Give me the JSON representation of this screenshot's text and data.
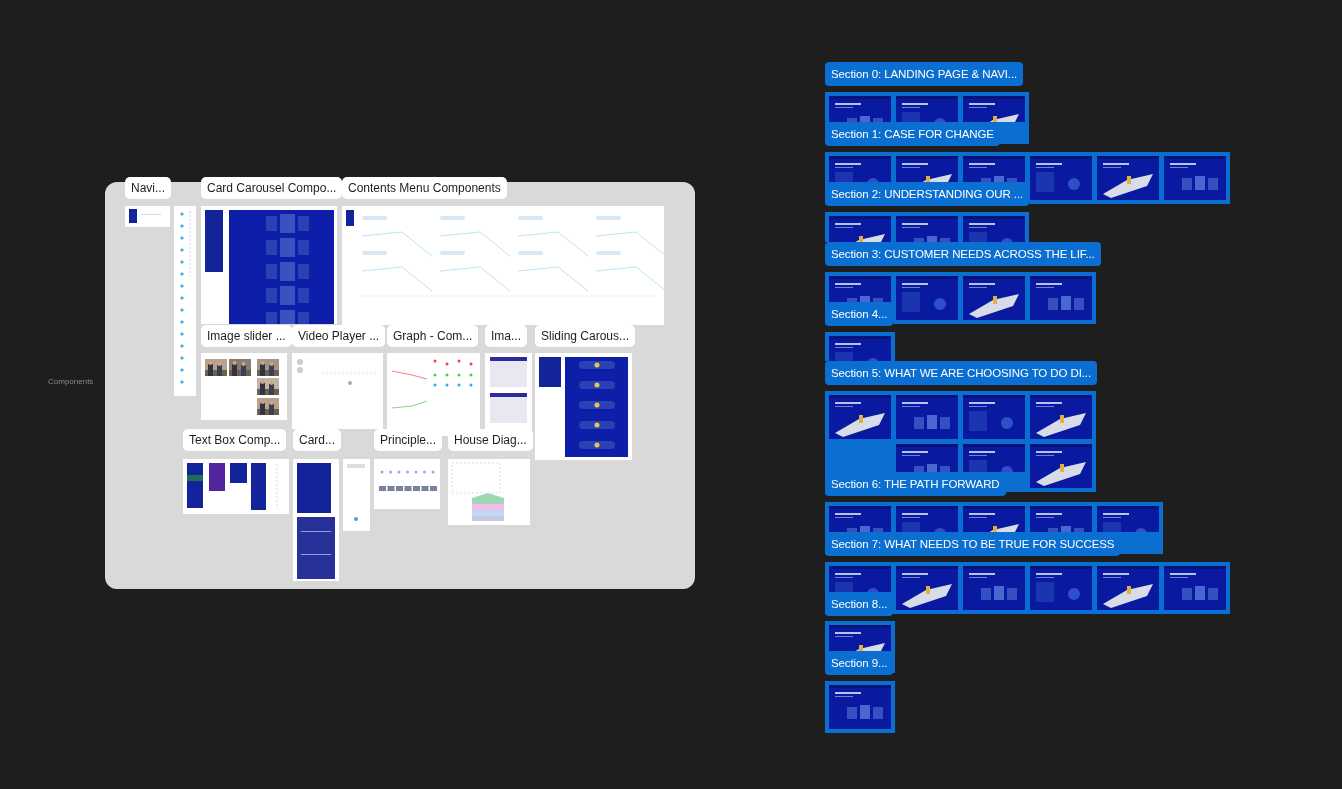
{
  "canvas_label": "Components",
  "components": {
    "frames": [
      {
        "label": "Navi..."
      },
      {
        "label": "Card Carousel Compo..."
      },
      {
        "label": "Contents Menu Components"
      },
      {
        "label": "Image slider ..."
      },
      {
        "label": "Video Player ..."
      },
      {
        "label": "Graph - Com..."
      },
      {
        "label": "Ima..."
      },
      {
        "label": "Sliding Carous..."
      },
      {
        "label": "Text Box Comp..."
      },
      {
        "label": "Card..."
      },
      {
        "label": "Principle..."
      },
      {
        "label": "House Diag..."
      }
    ]
  },
  "sections": [
    {
      "label": "Section 0: LANDING PAGE & NAVI..."
    },
    {
      "label": "Section 1: CASE FOR CHANGE",
      "slides": [
        {
          "kind": "picture"
        },
        {
          "kind": "picture"
        },
        {
          "kind": "picture"
        }
      ]
    },
    {
      "label": "Section 2: UNDERSTANDING OUR ...",
      "slides": [
        {
          "kind": "picture"
        },
        {
          "kind": "picture"
        },
        {
          "kind": "picture"
        },
        {
          "kind": "picture"
        },
        {
          "kind": "picture"
        },
        {
          "kind": "picture"
        }
      ]
    },
    {
      "label": "Section 3: CUSTOMER NEEDS ACROSS THE LIF...",
      "slides": [
        {
          "kind": "picture"
        },
        {
          "kind": "picture"
        },
        {
          "kind": "picture"
        }
      ]
    },
    {
      "label": "Section 4...",
      "slides": [
        {
          "kind": "picture"
        },
        {
          "kind": "picture"
        },
        {
          "kind": "picture"
        },
        {
          "kind": "picture"
        }
      ]
    },
    {
      "label": "Section 5: WHAT WE ARE CHOOSING TO DO DI...",
      "slides": [
        {
          "kind": "picture"
        }
      ]
    },
    {
      "label": "Section 6: THE PATH FORWARD",
      "slides": [
        {
          "kind": "picture"
        },
        {
          "kind": "picture"
        },
        {
          "kind": "picture"
        },
        {
          "kind": "picture"
        },
        {
          "kind": "picture"
        },
        {
          "kind": "picture"
        },
        {
          "kind": "picture"
        }
      ]
    },
    {
      "label": "Section 7: WHAT NEEDS TO BE TRUE FOR SUCCESS",
      "slides": [
        {
          "kind": "picture"
        },
        {
          "kind": "picture"
        },
        {
          "kind": "picture"
        },
        {
          "kind": "picture"
        },
        {
          "kind": "picture"
        }
      ]
    },
    {
      "label": "Section 8...",
      "slides": [
        {
          "kind": "picture"
        },
        {
          "kind": "picture"
        },
        {
          "kind": "picture"
        },
        {
          "kind": "picture"
        },
        {
          "kind": "picture"
        },
        {
          "kind": "picture"
        }
      ]
    },
    {
      "label": "Section 9...",
      "slides": [
        {
          "kind": "picture"
        }
      ]
    },
    {
      "slides": [
        {
          "kind": "picture"
        }
      ]
    }
  ]
}
